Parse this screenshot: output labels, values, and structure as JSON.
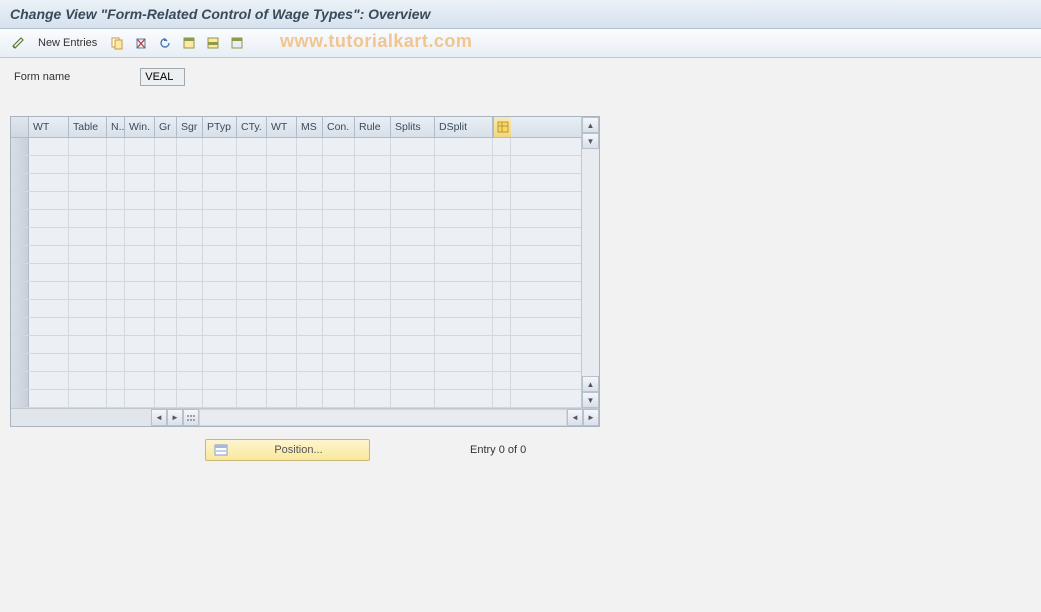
{
  "title": "Change View \"Form-Related Control of Wage Types\": Overview",
  "toolbar": {
    "new_entries_label": "New Entries"
  },
  "watermark": "www.tutorialkart.com",
  "form": {
    "name_label": "Form name",
    "name_value": "VEAL"
  },
  "table": {
    "columns": [
      "WT",
      "Table",
      "N..",
      "Win.",
      "Gr",
      "Sgr",
      "PTyp",
      "CTy.",
      "WT",
      "MS",
      "Con.",
      "Rule",
      "Splits",
      "DSplit"
    ],
    "row_count": 15
  },
  "footer": {
    "position_label": "Position...",
    "entry_text": "Entry 0 of 0"
  }
}
